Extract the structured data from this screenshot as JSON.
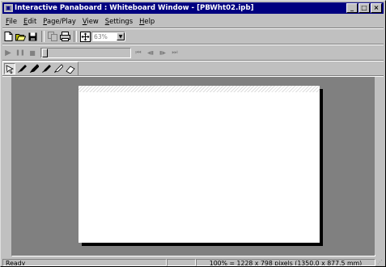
{
  "window": {
    "title": "Interactive Panaboard : Whiteboard Window - [PBWht02.ipb]",
    "app_icon": "panaboard-app-icon",
    "controls": {
      "minimize": "_",
      "maximize": "□",
      "close": "×"
    }
  },
  "menu": {
    "items": [
      {
        "key": "file",
        "underline": "F",
        "rest": "ile"
      },
      {
        "key": "edit",
        "underline": "E",
        "rest": "dit"
      },
      {
        "key": "page",
        "underline": "P",
        "rest": "age/Play"
      },
      {
        "key": "view",
        "underline": "V",
        "rest": "iew"
      },
      {
        "key": "settings",
        "underline": "S",
        "rest": "ettings"
      },
      {
        "key": "help",
        "underline": "H",
        "rest": "elp"
      }
    ]
  },
  "toolbar1": {
    "icons": [
      "new-document-icon",
      "open-folder-icon",
      "save-disk-icon",
      "copy-icon",
      "print-icon",
      "fit-page-icon"
    ],
    "zoom_value": "63%",
    "zoom_arrow": "▼"
  },
  "toolbar2": {
    "play": "▶",
    "pause": "❚❚",
    "stop": "■",
    "first": "⏮",
    "prev": "◀▮",
    "next": "▮▶",
    "last": "⏭"
  },
  "toolbar3": {
    "tools": [
      "select-arrow-icon",
      "pen-black-icon",
      "pen-blue-icon",
      "pen-red-icon",
      "pen-green-icon",
      "eraser-icon"
    ]
  },
  "status": {
    "left": "Ready",
    "middle": "",
    "info": "100% = 1228 x 798 pixels  (1350.0 x 877.5 mm)"
  },
  "colors": {
    "title_bg": "#000080",
    "workspace_bg": "#808080",
    "page_bg": "#ffffff",
    "chrome": "#c0c0c0"
  }
}
